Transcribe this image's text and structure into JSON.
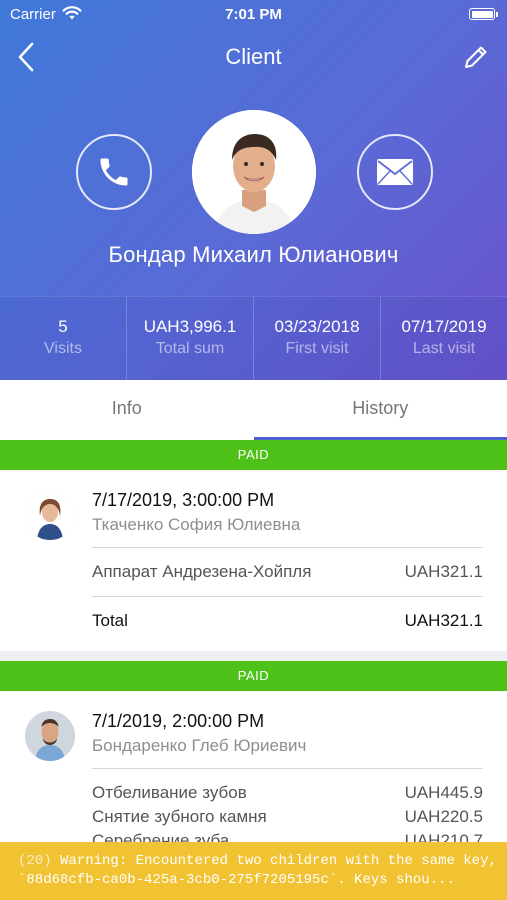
{
  "status_bar": {
    "carrier": "Carrier",
    "time": "7:01 PM"
  },
  "header": {
    "title": "Client",
    "back_icon": "chevron-left-icon",
    "edit_icon": "pencil-icon"
  },
  "client": {
    "name": "Бондар Михаил Юлианович",
    "call_icon": "phone-icon",
    "mail_icon": "envelope-icon"
  },
  "stats": [
    {
      "value": "5",
      "label": "Visits"
    },
    {
      "value": "UAH3,996.1",
      "label": "Total sum"
    },
    {
      "value": "03/23/2018",
      "label": "First visit"
    },
    {
      "value": "07/17/2019",
      "label": "Last visit"
    }
  ],
  "tabs": [
    {
      "label": "Info",
      "active": false
    },
    {
      "label": "History",
      "active": true
    }
  ],
  "visits": [
    {
      "status": "PAID",
      "date": "7/17/2019, 3:00:00 PM",
      "doctor": "Ткаченко София Юлиевна",
      "services": [
        {
          "name": "Аппарат Андрезена-Хойпля",
          "price": "UAH321.1"
        }
      ],
      "total_label": "Total",
      "total": "UAH321.1"
    },
    {
      "status": "PAID",
      "date": "7/1/2019, 2:00:00 PM",
      "doctor": "Бондаренко Глеб Юриевич",
      "services": [
        {
          "name": "Отбеливание зубов",
          "price": "UAH445.9"
        },
        {
          "name": "Снятие зубного камня",
          "price": "UAH220.5"
        },
        {
          "name": "Серебрение зуба",
          "price": "UAH210.7"
        }
      ]
    }
  ],
  "warning": {
    "count": "(20)",
    "line1": "Warning: Encountered two children with the same key,",
    "line2": "`88d68cfb-ca0b-425a-3cb0-275f7205195c`. Keys shou..."
  },
  "colors": {
    "paid_green": "#4fc21a",
    "accent": "#4c62d0",
    "warning_yellow": "#f1c232"
  }
}
